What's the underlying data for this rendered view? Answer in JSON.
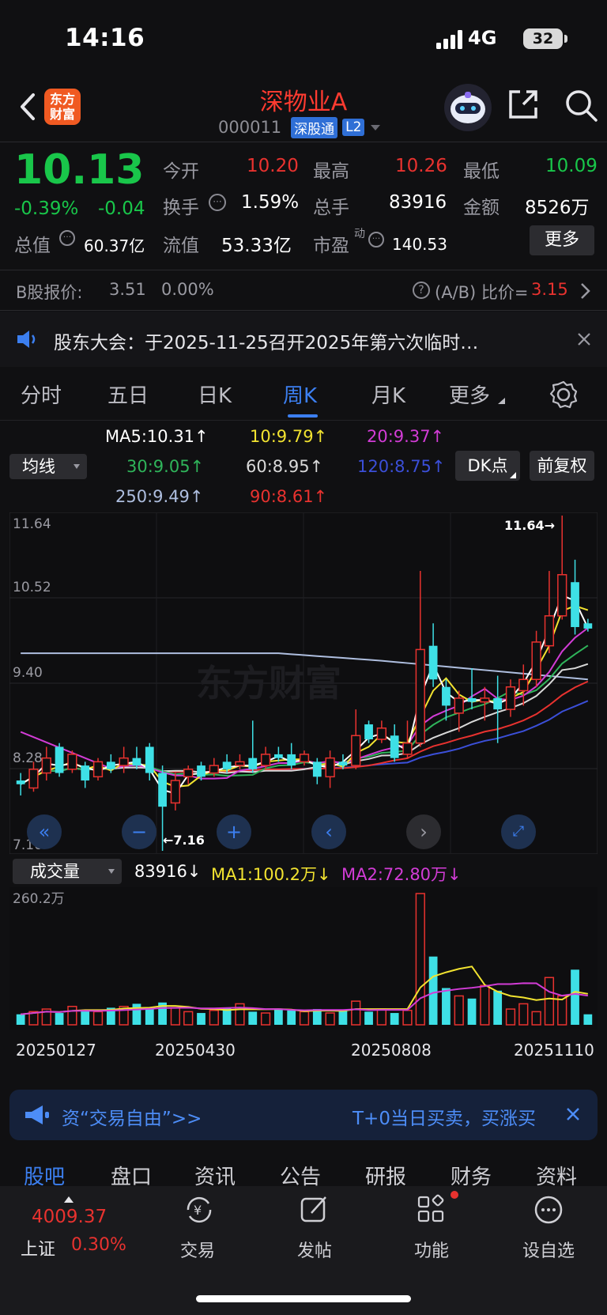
{
  "status": {
    "time": "14:16",
    "network": "4G",
    "battery": "32"
  },
  "header": {
    "stock_name": "深物业A",
    "stock_code": "000011",
    "tag_market": "深股通",
    "tag_level": "L2",
    "logo_text": "东方财富"
  },
  "quote": {
    "price": "10.13",
    "change_pct": "-0.39%",
    "change": "-0.04",
    "open_label": "今开",
    "open": "10.20",
    "high_label": "最高",
    "high": "10.26",
    "low_label": "最低",
    "low": "10.09",
    "turnover_label": "换手",
    "turnover": "1.59%",
    "volume_label": "总手",
    "volume": "83916",
    "amount_label": "金额",
    "amount": "8526万",
    "total_value_label": "总值",
    "total_value": "60.37亿",
    "float_value_label": "流值",
    "float_value": "53.33亿",
    "pe_label": "市盈",
    "pe_sup": "动",
    "pe": "140.53",
    "more": "更多"
  },
  "b_share": {
    "label": "B股报价:",
    "price": "3.51",
    "pct": "0.00%",
    "ratio_label": "(A/B) 比价=",
    "ratio": "3.15"
  },
  "notice": {
    "text": "股东大会：于2025-11-25召开2025年第六次临时…"
  },
  "tabs": [
    "分时",
    "五日",
    "日K",
    "周K",
    "月K",
    "更多"
  ],
  "ma_legend": {
    "selector": "均线",
    "ma5": "MA5:10.31↑",
    "ma10": "10:9.79↑",
    "ma20": "20:9.37↑",
    "ma30": "30:9.05↑",
    "ma60": "60:8.95↑",
    "ma120": "120:8.75↑",
    "ma250": "250:9.49↑",
    "ma90": "90:8.61↑",
    "dk_button": "DK点",
    "adjust_button": "前复权"
  },
  "colors": {
    "ma5": "#ffffff",
    "ma10": "#f2e330",
    "ma20": "#d23cd6",
    "ma30": "#2fb45a",
    "ma60": "#d9d9d9",
    "ma120": "#3b4fd8",
    "ma250": "#aebedf",
    "ma90": "#e8322f",
    "up": "#e8322f",
    "down": "#3ee0e6"
  },
  "chart_labels": {
    "y_top": "11.64",
    "y_2": "10.52",
    "y_3": "9.40",
    "y_4": "8.28",
    "y_bottom": "7.16",
    "max_marker": "11.64→",
    "min_marker": "←7.16"
  },
  "volume": {
    "selector": "成交量",
    "value": "83916↓",
    "ma1": "MA1:100.2万↓",
    "ma2": "MA2:72.80万↓",
    "y_top": "260.2万"
  },
  "dates": [
    "20250127",
    "20250430",
    "20250808",
    "20251110"
  ],
  "promo": {
    "left": "资“交易自由”>>",
    "right": "T+0当日买卖，买涨买"
  },
  "sub_tabs": [
    "股吧",
    "盘口",
    "资讯",
    "公告",
    "研报",
    "财务",
    "资料"
  ],
  "bottom": {
    "index_value": "4009.37",
    "index_name": "上证",
    "index_pct": "0.30%",
    "trade": "交易",
    "post": "发帖",
    "func": "功能",
    "watch": "设自选"
  },
  "chart_data": {
    "type": "candlestick",
    "y_range": [
      7.16,
      11.64
    ],
    "ticks_y": [
      "11.64",
      "10.52",
      "9.40",
      "8.28",
      "7.16"
    ],
    "x_labels": [
      "20250127",
      "20250430",
      "20250808",
      "20251110"
    ],
    "candles": [
      {
        "o": 8.1,
        "c": 8.05,
        "h": 8.2,
        "l": 7.9
      },
      {
        "o": 8.0,
        "c": 8.25,
        "h": 8.35,
        "l": 7.95
      },
      {
        "o": 8.2,
        "c": 8.4,
        "h": 8.55,
        "l": 8.1
      },
      {
        "o": 8.55,
        "c": 8.2,
        "h": 8.6,
        "l": 8.15
      },
      {
        "o": 8.25,
        "c": 8.45,
        "h": 8.5,
        "l": 8.2
      },
      {
        "o": 8.3,
        "c": 8.1,
        "h": 8.35,
        "l": 8.0
      },
      {
        "o": 8.15,
        "c": 8.35,
        "h": 8.4,
        "l": 8.1
      },
      {
        "o": 8.35,
        "c": 8.25,
        "h": 8.45,
        "l": 8.2
      },
      {
        "o": 8.3,
        "c": 8.4,
        "h": 8.55,
        "l": 8.2
      },
      {
        "o": 8.4,
        "c": 8.3,
        "h": 8.55,
        "l": 8.25
      },
      {
        "o": 8.55,
        "c": 8.2,
        "h": 8.6,
        "l": 8.1
      },
      {
        "o": 8.2,
        "c": 7.75,
        "h": 8.3,
        "l": 7.16
      },
      {
        "o": 7.8,
        "c": 8.1,
        "h": 8.2,
        "l": 7.7
      },
      {
        "o": 8.15,
        "c": 8.25,
        "h": 8.3,
        "l": 8.05
      },
      {
        "o": 8.3,
        "c": 8.15,
        "h": 8.35,
        "l": 8.1
      },
      {
        "o": 8.2,
        "c": 8.3,
        "h": 8.4,
        "l": 8.15
      },
      {
        "o": 8.35,
        "c": 8.25,
        "h": 8.45,
        "l": 8.2
      },
      {
        "o": 8.3,
        "c": 8.35,
        "h": 8.45,
        "l": 8.25
      },
      {
        "o": 8.4,
        "c": 8.25,
        "h": 8.9,
        "l": 8.2
      },
      {
        "o": 8.3,
        "c": 8.45,
        "h": 8.55,
        "l": 8.25
      },
      {
        "o": 8.45,
        "c": 8.4,
        "h": 8.55,
        "l": 8.35
      },
      {
        "o": 8.45,
        "c": 8.3,
        "h": 8.6,
        "l": 8.25
      },
      {
        "o": 8.35,
        "c": 8.45,
        "h": 8.5,
        "l": 8.3
      },
      {
        "o": 8.35,
        "c": 8.15,
        "h": 8.4,
        "l": 8.05
      },
      {
        "o": 8.15,
        "c": 8.4,
        "h": 8.5,
        "l": 8.0
      },
      {
        "o": 8.35,
        "c": 8.3,
        "h": 8.45,
        "l": 8.25
      },
      {
        "o": 8.3,
        "c": 8.7,
        "h": 9.05,
        "l": 8.25
      },
      {
        "o": 8.85,
        "c": 8.65,
        "h": 8.9,
        "l": 8.6
      },
      {
        "o": 8.65,
        "c": 8.8,
        "h": 8.9,
        "l": 8.6
      },
      {
        "o": 8.7,
        "c": 8.4,
        "h": 8.85,
        "l": 8.35
      },
      {
        "o": 8.45,
        "c": 8.6,
        "h": 8.9,
        "l": 8.4
      },
      {
        "o": 8.6,
        "c": 9.85,
        "h": 10.9,
        "l": 8.55
      },
      {
        "o": 9.9,
        "c": 9.45,
        "h": 10.2,
        "l": 9.35
      },
      {
        "o": 9.35,
        "c": 9.1,
        "h": 9.45,
        "l": 8.9
      },
      {
        "o": 9.0,
        "c": 9.2,
        "h": 9.3,
        "l": 8.75
      },
      {
        "o": 9.2,
        "c": 9.15,
        "h": 9.6,
        "l": 9.05
      },
      {
        "o": 9.15,
        "c": 9.2,
        "h": 9.35,
        "l": 8.9
      },
      {
        "o": 9.2,
        "c": 9.05,
        "h": 9.5,
        "l": 8.6
      },
      {
        "o": 9.05,
        "c": 9.35,
        "h": 9.45,
        "l": 8.95
      },
      {
        "o": 9.3,
        "c": 9.45,
        "h": 9.65,
        "l": 9.1
      },
      {
        "o": 9.45,
        "c": 9.95,
        "h": 10.1,
        "l": 9.35
      },
      {
        "o": 9.9,
        "c": 10.3,
        "h": 10.9,
        "l": 9.8
      },
      {
        "o": 10.3,
        "c": 10.85,
        "h": 11.64,
        "l": 10.25
      },
      {
        "o": 10.75,
        "c": 10.15,
        "h": 11.05,
        "l": 10.05
      },
      {
        "o": 10.2,
        "c": 10.13,
        "h": 10.26,
        "l": 10.09
      }
    ],
    "volume_bars": [
      8,
      10,
      12,
      9,
      14,
      11,
      10,
      13,
      14,
      16,
      12,
      17,
      13,
      10,
      9,
      11,
      13,
      16,
      10,
      9,
      12,
      11,
      10,
      12,
      9,
      11,
      18,
      10,
      12,
      9,
      11,
      100,
      52,
      28,
      22,
      20,
      30,
      26,
      12,
      16,
      10,
      36,
      22,
      42,
      8
    ],
    "volume_y_top": "260.2万"
  }
}
